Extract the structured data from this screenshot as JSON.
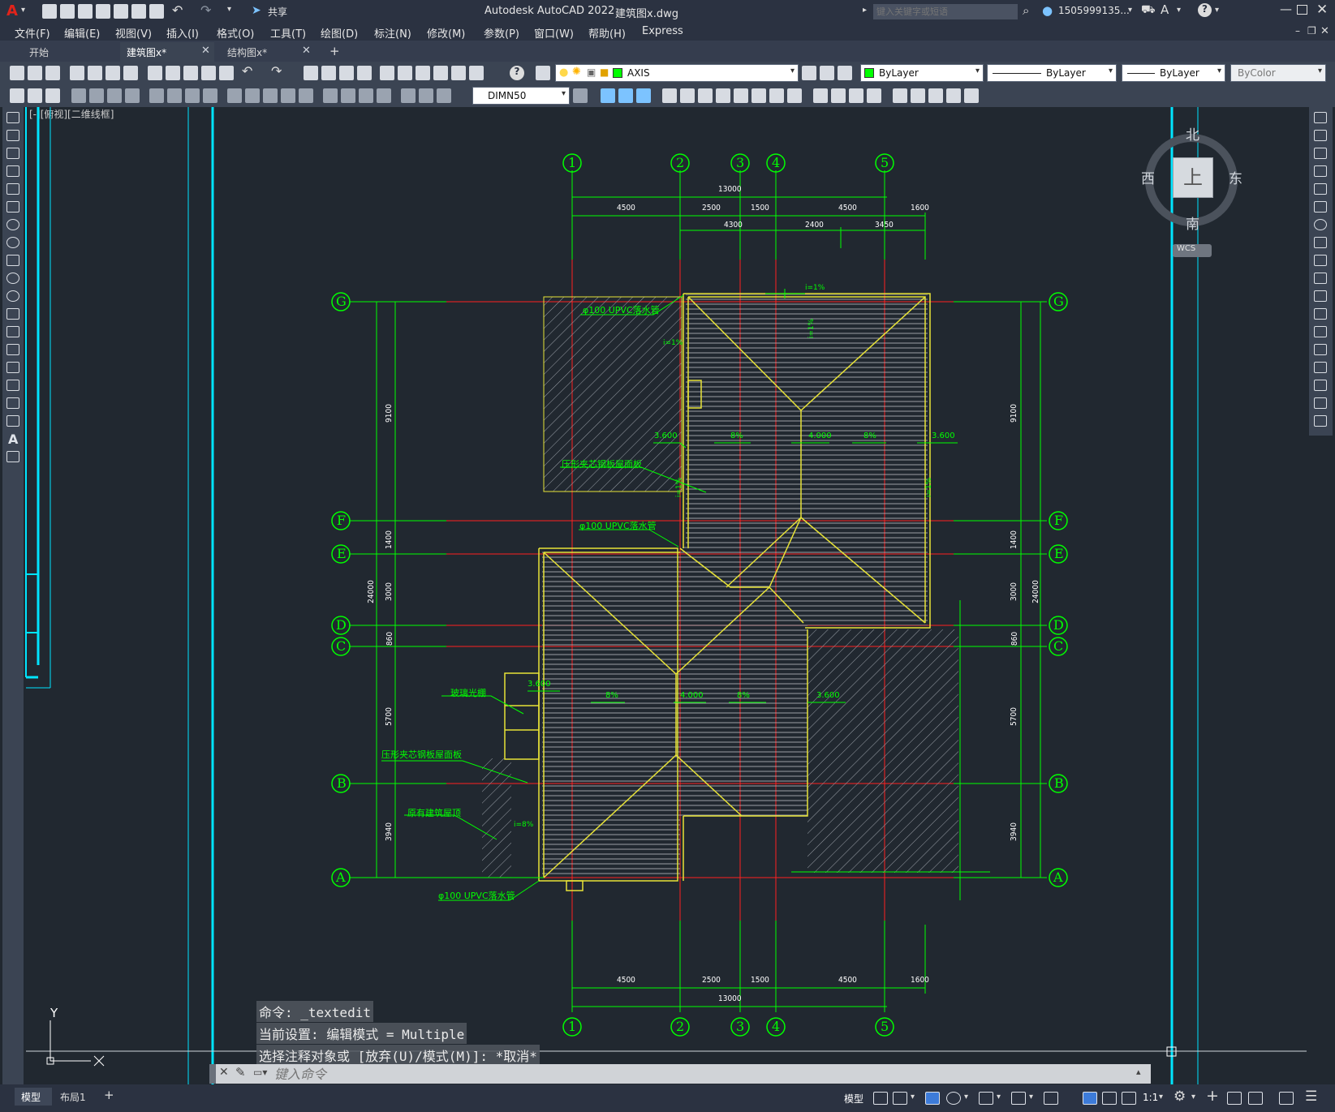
{
  "app": {
    "title": "Autodesk AutoCAD 2022",
    "filename": "建筑图x.dwg",
    "share_label": "共享",
    "search_placeholder": "键入关键字或短语",
    "user": "1505999135...",
    "logo": "A"
  },
  "menu": [
    "文件(F)",
    "编辑(E)",
    "视图(V)",
    "插入(I)",
    "格式(O)",
    "工具(T)",
    "绘图(D)",
    "标注(N)",
    "修改(M)",
    "参数(P)",
    "窗口(W)",
    "帮助(H)",
    "Express"
  ],
  "tabs": [
    {
      "label": "开始",
      "active": false,
      "closable": false
    },
    {
      "label": "建筑图x*",
      "active": true,
      "closable": true
    },
    {
      "label": "结构图x*",
      "active": false,
      "closable": true
    }
  ],
  "toolbar": {
    "layer": "AXIS",
    "layer_color": "#00ff00",
    "color_combo": "ByLayer",
    "linetype_combo": "ByLayer",
    "lineweight_combo": "ByLayer",
    "plotstyle_combo": "ByColor",
    "dimstyle": "DIMN50"
  },
  "viewport": {
    "label": "[-][俯视][二维线框]",
    "viewcube": {
      "north": "北",
      "south": "南",
      "east": "东",
      "west": "西",
      "face": "上",
      "wcs": "WCS"
    },
    "ucs": {
      "y": "Y"
    }
  },
  "drawing": {
    "col_axes": [
      "1",
      "2",
      "3",
      "4",
      "5"
    ],
    "row_axes": [
      "G",
      "F",
      "E",
      "D",
      "C",
      "B",
      "A"
    ],
    "top_dims": [
      "13000",
      "4500",
      "2500",
      "1500",
      "4500",
      "1600",
      "4300",
      "2400",
      "3450"
    ],
    "bottom_dims": [
      "4500",
      "2500",
      "1500",
      "4500",
      "1600",
      "13000"
    ],
    "left_dims": [
      "9100",
      "1400",
      "3000",
      "860",
      "5700",
      "3940",
      "24000"
    ],
    "right_dims": [
      "9100",
      "1400",
      "3000",
      "860",
      "5700",
      "3940",
      "24000"
    ],
    "labels": {
      "pipe1": "φ100 UPVC落水管",
      "pipe2": "φ100 UPVC落水管",
      "pipe3": "φ100 UPVC落水管",
      "panel1": "压形夹芯钢板屋面板",
      "panel2": "压形夹芯钢板屋面板",
      "glass": "玻璃光棚",
      "existing": "原有建筑屋顶",
      "slope1": "i=1%",
      "slope2": "i=1%",
      "slope3": "i=1%",
      "slope4": "i=1%",
      "slope5": "i=8%",
      "slope6": "i=1%",
      "elev1": "3.600",
      "elev2": "4.000",
      "elev3": "3.600",
      "elev4": "3.600",
      "elev5": "4.000",
      "elev6": "3.600",
      "pct1": "8%",
      "pct2": "8%",
      "pct3": "8%",
      "pct4": "8%"
    }
  },
  "command": {
    "history": [
      "命令: _textedit",
      "当前设置: 编辑模式 = Multiple",
      "选择注释对象或 [放弃(U)/模式(M)]: *取消*"
    ],
    "placeholder": "键入命令"
  },
  "status": {
    "layout_tabs": [
      "模型",
      "布局1"
    ],
    "model_label": "模型",
    "scale": "1:1"
  }
}
